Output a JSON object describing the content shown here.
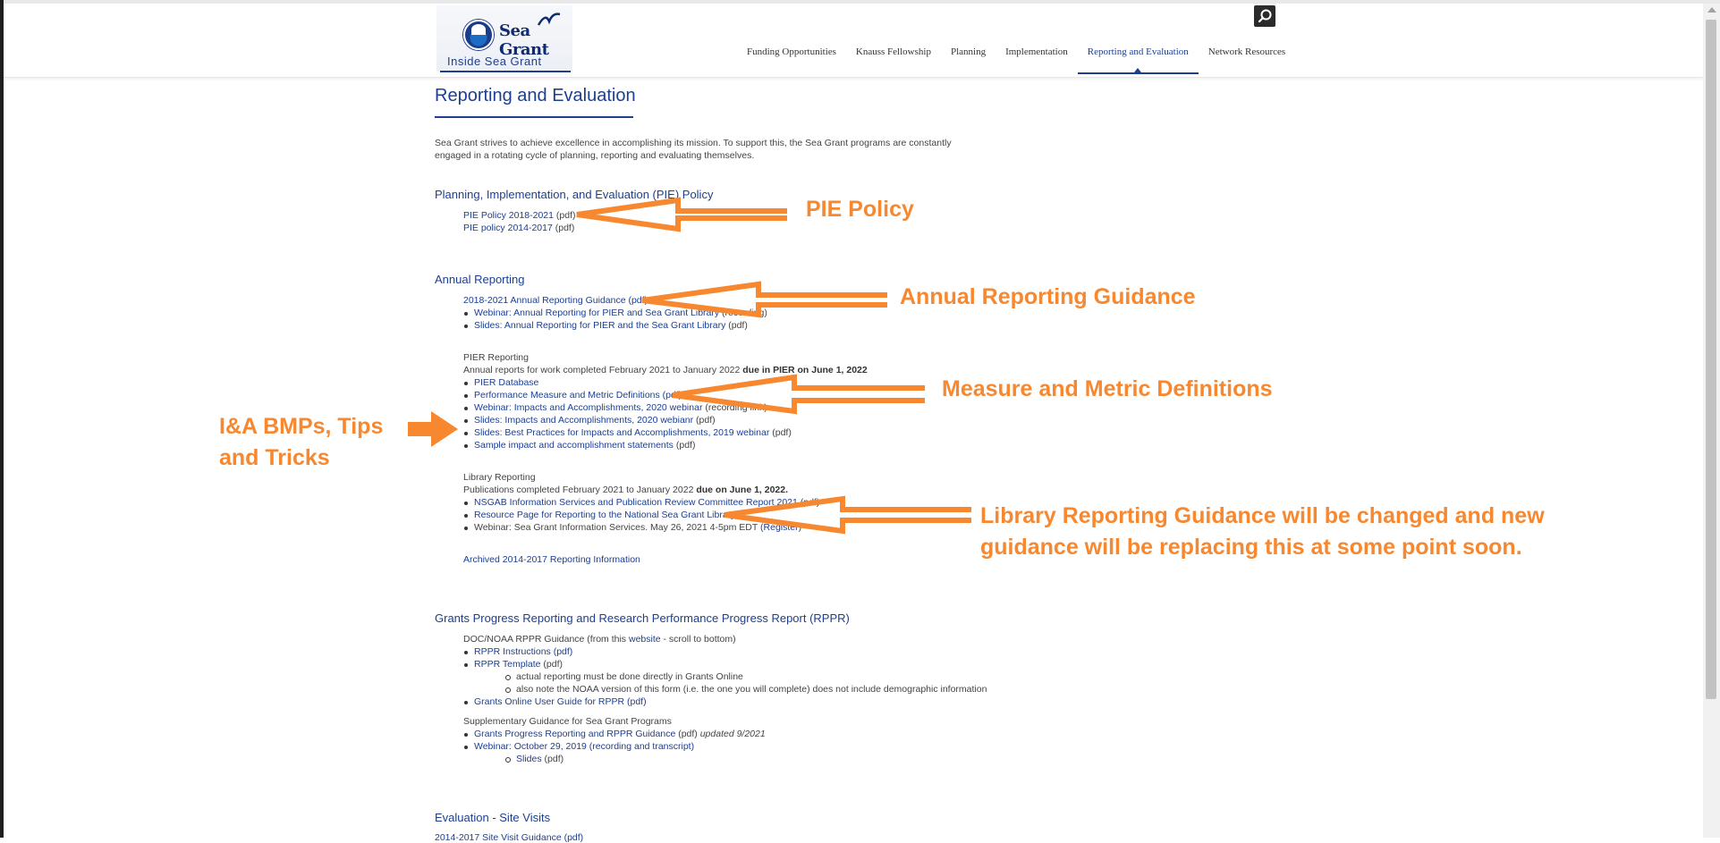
{
  "logo": {
    "brand": "Sea Grant",
    "tagline": "Inside Sea Grant"
  },
  "nav": {
    "items": [
      {
        "label": "Funding Opportunities"
      },
      {
        "label": "Knauss Fellowship"
      },
      {
        "label": "Planning"
      },
      {
        "label": "Implementation"
      },
      {
        "label": "Reporting and Evaluation"
      },
      {
        "label": "Network Resources"
      }
    ],
    "active": "Reporting and Evaluation"
  },
  "page": {
    "title": "Reporting and Evaluation",
    "intro": "Sea Grant strives to achieve excellence in accomplishing its mission. To support this, the Sea Grant programs are constantly engaged in a rotating cycle of planning, reporting and evaluating themselves."
  },
  "pie": {
    "heading": "Planning, Implementation, and Evaluation (PIE) Policy",
    "link1": "PIE Policy 2018-2021",
    "link1_suffix": " (pdf)",
    "link2": "PIE policy 2014-2017",
    "link2_suffix": " (pdf)"
  },
  "annual": {
    "heading": "Annual Reporting",
    "guidance": "2018-2021 Annual Reporting Guidance (pdf)",
    "webinar": "Webinar: Annual Reporting for PIER and Sea Grant Library",
    "webinar_suffix": " (recording)",
    "slides": "Slides: Annual Reporting for PIER and the Sea Grant Library",
    "slides_suffix": " (pdf)"
  },
  "pier": {
    "label": "PIER Reporting",
    "desc": "Annual reports for work completed February 2021 to January 2022 ",
    "due": "due in PIER on June 1, 2022",
    "items": {
      "db": "PIER Database",
      "defs": "Performance Measure and Metric Definitions (pdf)",
      "webinar": "Webinar: Impacts and Accomplishments, 2020 webinar",
      "webinar_suffix": " (recording link)",
      "slides": "Slides: Impacts and Accomplishments, 2020 webianr",
      "slides_suffix": " (pdf)",
      "best": "Slides: Best Practices for Impacts and Accomplishments, 2019 webinar",
      "best_suffix": " (pdf)",
      "sample": "Sample impact and accomplishment statements",
      "sample_suffix": " (pdf)"
    }
  },
  "library": {
    "label": "Library Reporting",
    "desc": "Publications completed February 2021 to January 2022 ",
    "due": "due on June 1, 2022.",
    "nsgab": "NSGAB Information Services and Publication Review Committee Report 2021",
    "nsgab_suffix": " (pdf)",
    "resource": "Resource Page for Reporting to the National Sea Grant Library",
    "webinar": "Webinar: Sea Grant Information Services. May 26, 2021 4-5pm EDT (",
    "register": "Register",
    "close": ")",
    "archived": "Archived 2014-2017 Reporting Information"
  },
  "rppr": {
    "heading": "Grants Progress Reporting and Research Performance Progress Report (RPPR)",
    "doc_prefix": "DOC/NOAA RPPR Guidance (from this ",
    "doc_link": "website",
    "doc_suffix": " - scroll to bottom)",
    "instructions": "RPPR Instructions (pdf)",
    "template": "RPPR Template",
    "template_suffix": " (pdf)",
    "sub1": "actual reporting must be done directly in Grants Online",
    "sub2": "also note the NOAA version of this form (i.e. the one you will complete) does not include demographic information",
    "user_guide": "Grants Online User Guide for RPPR (pdf)",
    "supp_label": "Supplementary Guidance for Sea Grant Programs",
    "gpr": "Grants Progress Reporting and RPPR Guidance",
    "gpr_suffix": " (pdf) ",
    "gpr_updated": "updated 9/2021",
    "webinar": "Webinar: October 29, 2019 (recording and transcript)",
    "slides": "Slides",
    "slides_suffix": " (pdf)"
  },
  "evaluation": {
    "heading": "Evaluation - Site Visits",
    "partial": "2014-2017 Site Visit Guidance (pdf)"
  },
  "annotations": {
    "pie": "PIE Policy",
    "annual": "Annual Reporting Guidance",
    "measure": "Measure and Metric Definitions",
    "ia_line1": "I&A BMPs, Tips",
    "ia_line2": "and Tricks",
    "library_line1": "Library Reporting Guidance will be changed and new",
    "library_line2": "guidance will be replacing this at some point soon."
  },
  "colors": {
    "accent": "#1d3f90",
    "annotation": "#f7882f"
  },
  "icons": {
    "search": "search-icon",
    "logo": "noaa-logo-icon"
  }
}
